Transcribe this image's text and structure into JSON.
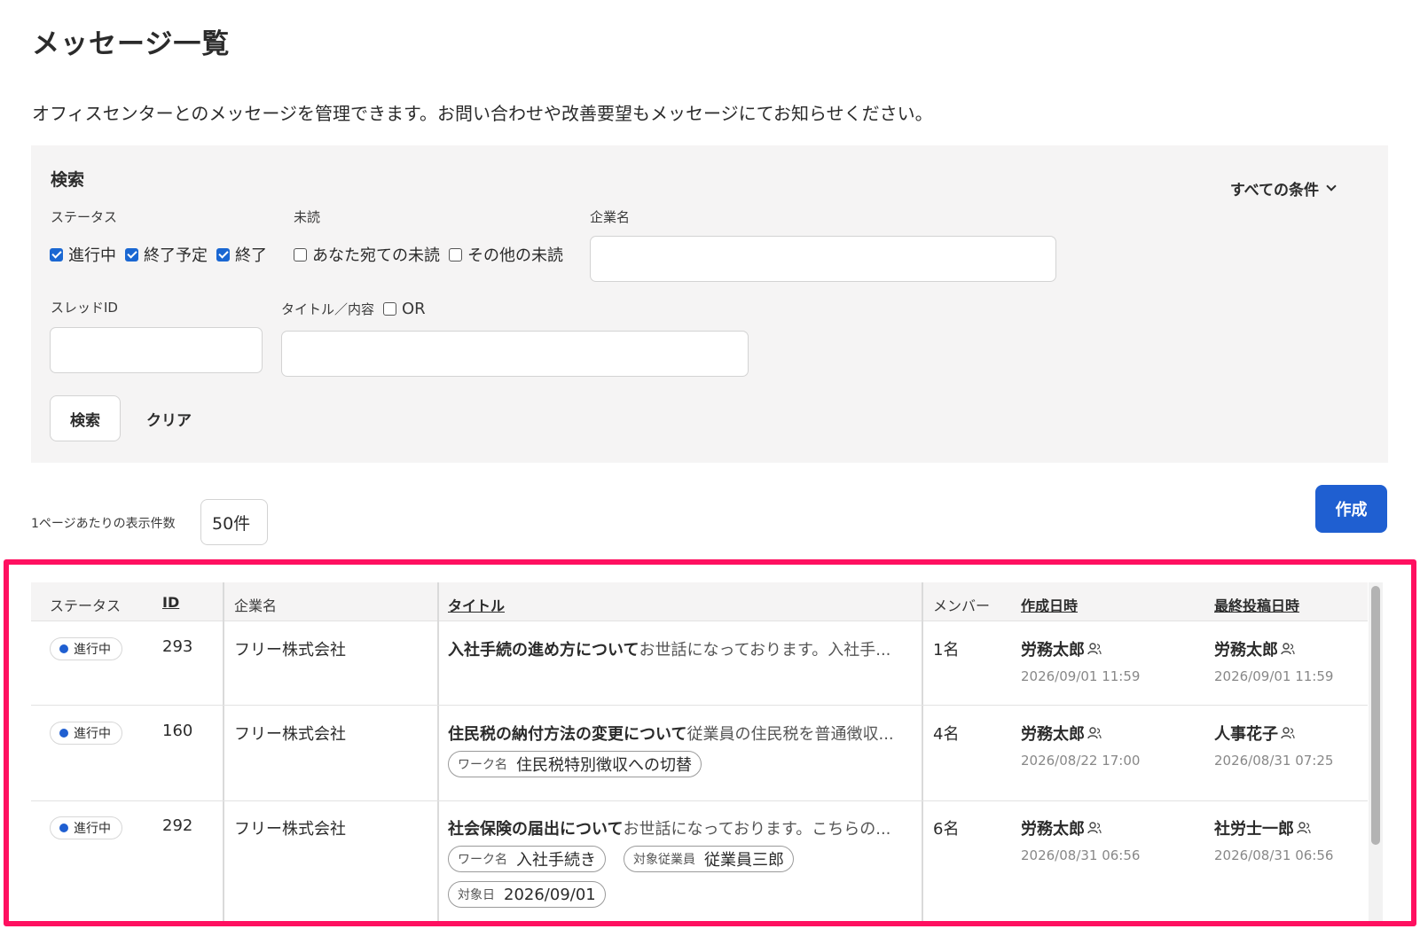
{
  "page": {
    "title": "メッセージ一覧",
    "description": "オフィスセンターとのメッセージを管理できます。お問い合わせや改善要望もメッセージにてお知らせください。"
  },
  "search": {
    "heading": "検索",
    "all_conditions": "すべての条件",
    "status_label": "ステータス",
    "status_options": [
      {
        "label": "進行中",
        "checked": true
      },
      {
        "label": "終了予定",
        "checked": true
      },
      {
        "label": "終了",
        "checked": true
      }
    ],
    "unread_label": "未読",
    "unread_options": [
      {
        "label": "あなた宛ての未読",
        "checked": false
      },
      {
        "label": "その他の未読",
        "checked": false
      }
    ],
    "company_label": "企業名",
    "company_value": "",
    "thread_id_label": "スレッドID",
    "thread_id_value": "",
    "title_content_label": "タイトル／内容",
    "or_label": "OR",
    "or_checked": false,
    "title_content_value": "",
    "search_button": "検索",
    "clear_button": "クリア"
  },
  "pagination": {
    "per_page_label": "1ページあたりの表示件数",
    "per_page_value": "50件"
  },
  "create_button": "作成",
  "table": {
    "headers": {
      "status": "ステータス",
      "id": "ID",
      "company": "企業名",
      "title": "タイトル",
      "members": "メンバー",
      "created": "作成日時",
      "last_post": "最終投稿日時"
    },
    "rows": [
      {
        "status": "進行中",
        "id": "293",
        "company": "フリー株式会社",
        "title": "入社手続の進め方について",
        "excerpt": "お世話になっております。入社手...",
        "tags": [],
        "members": "1名",
        "created_by": "労務太郎",
        "created_at": "2026/09/01 11:59",
        "last_by": "労務太郎",
        "last_at": "2026/09/01 11:59"
      },
      {
        "status": "進行中",
        "id": "160",
        "company": "フリー株式会社",
        "title": "住民税の納付方法の変更について",
        "excerpt": "従業員の住民税を普通徴収...",
        "tags": [
          {
            "key": "ワーク名",
            "value": "住民税特別徴収への切替"
          }
        ],
        "members": "4名",
        "created_by": "労務太郎",
        "created_at": "2026/08/22 17:00",
        "last_by": "人事花子",
        "last_at": "2026/08/31 07:25"
      },
      {
        "status": "進行中",
        "id": "292",
        "company": "フリー株式会社",
        "title": "社会保険の届出について",
        "excerpt": "お世話になっております。こちらの...",
        "tags": [
          {
            "key": "ワーク名",
            "value": "入社手続き"
          },
          {
            "key": "対象従業員",
            "value": "従業員三郎"
          },
          {
            "key": "対象日",
            "value": "2026/09/01"
          }
        ],
        "members": "6名",
        "created_by": "労務太郎",
        "created_at": "2026/08/31 06:56",
        "last_by": "社労士一郎",
        "last_at": "2026/08/31 06:56"
      }
    ]
  },
  "colors": {
    "accent": "#1f5fd1",
    "highlight": "#ff1060",
    "panel_bg": "#f5f4f4"
  },
  "icons": {
    "person": "person-icon",
    "chevron": "chevron-down-icon",
    "status_dot": "status-dot-icon"
  }
}
